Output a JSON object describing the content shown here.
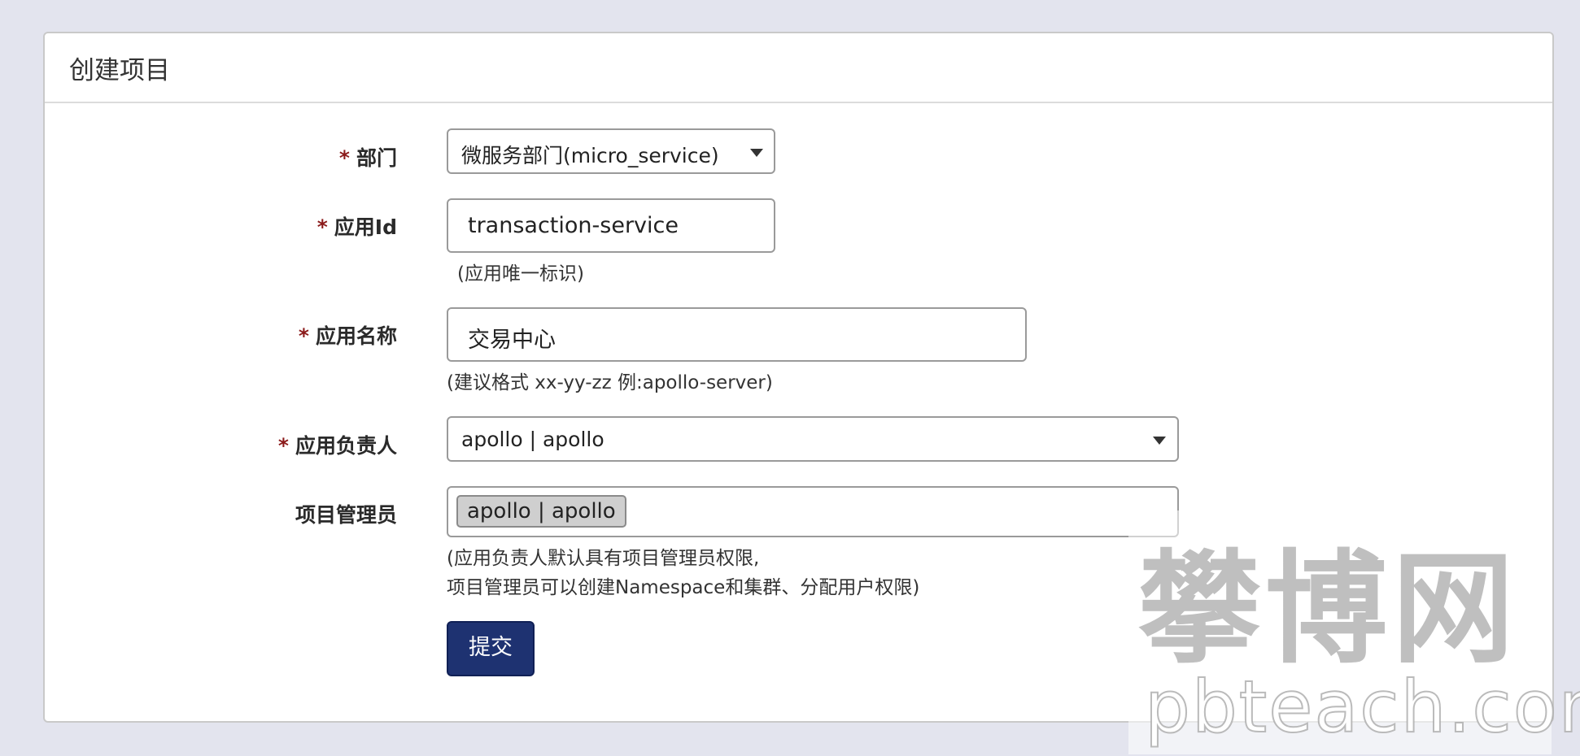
{
  "panel": {
    "title": "创建项目"
  },
  "form": {
    "required_mark": "*",
    "department": {
      "label": "部门",
      "value": "微服务部门(micro_service)"
    },
    "app_id": {
      "label": "应用Id",
      "value": "transaction-service",
      "hint": "(应用唯一标识)"
    },
    "app_name": {
      "label": "应用名称",
      "value": "交易中心",
      "hint": "(建议格式 xx-yy-zz 例:apollo-server)"
    },
    "owner": {
      "label": "应用负责人",
      "value": "apollo | apollo"
    },
    "admins": {
      "label": "项目管理员",
      "tags": [
        "apollo | apollo"
      ],
      "hint_line1": "(应用负责人默认具有项目管理员权限,",
      "hint_line2": "项目管理员可以创建Namespace和集群、分配用户权限)"
    },
    "submit_label": "提交"
  },
  "watermark": {
    "text_cn": "攀博网",
    "text_en": "pbteach.com"
  }
}
